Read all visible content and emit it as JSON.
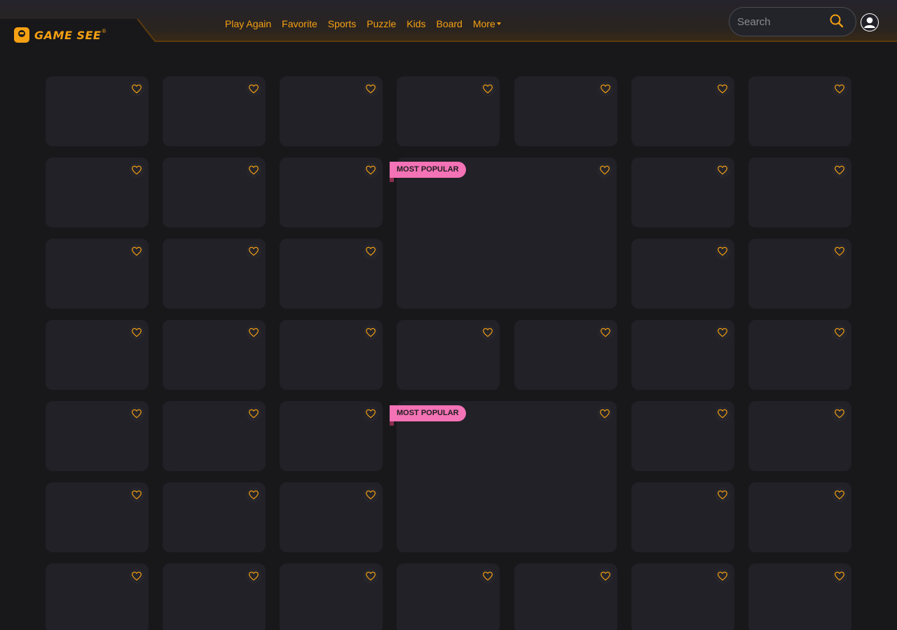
{
  "header": {
    "logo_text": "GAME SEE",
    "logo_mark": "®",
    "nav": [
      {
        "label": "Play Again"
      },
      {
        "label": "Favorite"
      },
      {
        "label": "Sports"
      },
      {
        "label": "Puzzle"
      },
      {
        "label": "Kids"
      },
      {
        "label": "Board"
      }
    ],
    "more_label": "More",
    "search_placeholder": "Search",
    "icons": {
      "search": "search-icon",
      "account": "user-avatar-icon",
      "favorite": "heart-icon"
    }
  },
  "featured_badge": "MOST POPULAR",
  "colors": {
    "accent": "#f5a013",
    "background": "#18181b",
    "card": "#222127",
    "badge": "#f472b6"
  }
}
